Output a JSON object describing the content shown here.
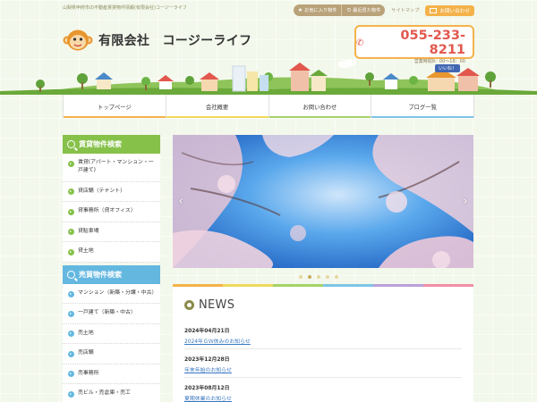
{
  "header": {
    "tagline": "山梨県甲府市の不動産賃貸物件情報(有限会社)コージーライフ",
    "top_links": {
      "favorite": "お気に入り物件",
      "recent": "最近見た物件",
      "sitemap": "サイトマップ",
      "contact": "お問い合わせ"
    },
    "company_name": "有限会社　コージーライフ",
    "phone": "055-233-8211",
    "hours": "営業時間9：00～18：00",
    "like_label": "いいね！"
  },
  "nav": {
    "items": [
      {
        "label": "トップページ"
      },
      {
        "label": "会社概要"
      },
      {
        "label": "お問い合わせ"
      },
      {
        "label": "ブログ一覧"
      }
    ]
  },
  "sidebar": {
    "rental": {
      "title": "賃貸物件検索",
      "items": [
        {
          "label": "賃貸(アパート・マンション・一戸建て)"
        },
        {
          "label": "貸店舗（テナント）"
        },
        {
          "label": "貸事務所（貸オフィス）"
        },
        {
          "label": "貸駐車場"
        },
        {
          "label": "貸土地"
        }
      ]
    },
    "sale": {
      "title": "売買物件検索",
      "items": [
        {
          "label": "マンション（新築・分譲・中古）"
        },
        {
          "label": "一戸建て（新築・中古）"
        },
        {
          "label": "売土地"
        },
        {
          "label": "売店舗"
        },
        {
          "label": "売事務所"
        },
        {
          "label": "売ビル・売倉庫・売工"
        }
      ]
    }
  },
  "slider": {
    "slide_count": 5,
    "active_index": 1
  },
  "news": {
    "title": "NEWS",
    "items": [
      {
        "date": "2024年04月21日",
        "title": "2024年ＧＷ休みのお知らせ"
      },
      {
        "date": "2023年12月28日",
        "title": "年末年始のお知らせ"
      },
      {
        "date": "2023年08月12日",
        "title": "夏期休業のお知らせ"
      }
    ]
  },
  "colors": {
    "accent_orange": "#f4b24a",
    "rental_green": "#86c14a",
    "sale_blue": "#64b8e0",
    "phone_red": "#e2584e",
    "link_blue": "#3a77c0"
  }
}
